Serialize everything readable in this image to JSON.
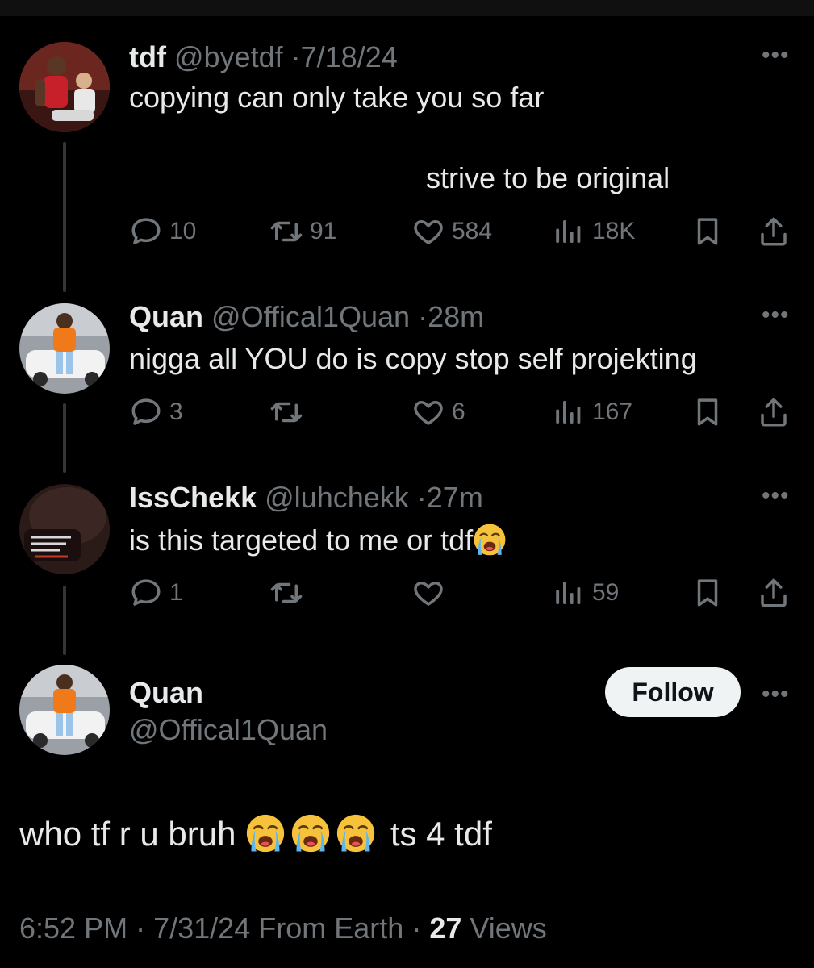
{
  "tweets": [
    {
      "name": "tdf",
      "handle": "@byetdf",
      "time": "7/18/24",
      "text_line1": "copying can only take you so far",
      "text_line2": "strive to be original",
      "replies": "10",
      "reposts": "91",
      "likes": "584",
      "views": "18K"
    },
    {
      "name": "Quan",
      "handle": "@Offical1Quan",
      "time": "28m",
      "text": "nigga all YOU do is copy stop self projekting",
      "replies": "3",
      "reposts": "",
      "likes": "6",
      "views": "167"
    },
    {
      "name": "IssChekk",
      "handle": "@luhchekk",
      "time": "27m",
      "text": "is this targeted to me or tdf",
      "replies": "1",
      "reposts": "",
      "likes": "",
      "views": "59"
    }
  ],
  "main_tweet": {
    "name": "Quan",
    "handle": "@Offical1Quan",
    "follow_label": "Follow",
    "text_before": "who tf r u bruh",
    "text_after": "ts 4 tdf",
    "time": "6:52 PM",
    "date": "7/31/24",
    "source": "From Earth",
    "views_count": "27",
    "views_label": "Views"
  },
  "icons": [
    "reply-icon",
    "repost-icon",
    "like-icon",
    "views-icon",
    "bookmark-icon",
    "share-icon",
    "more-icon",
    "loudly-crying-emoji"
  ],
  "colors": {
    "background": "#000000",
    "text": "#e7e9ea",
    "muted": "#71767b",
    "follow_button": "#eff3f4"
  }
}
